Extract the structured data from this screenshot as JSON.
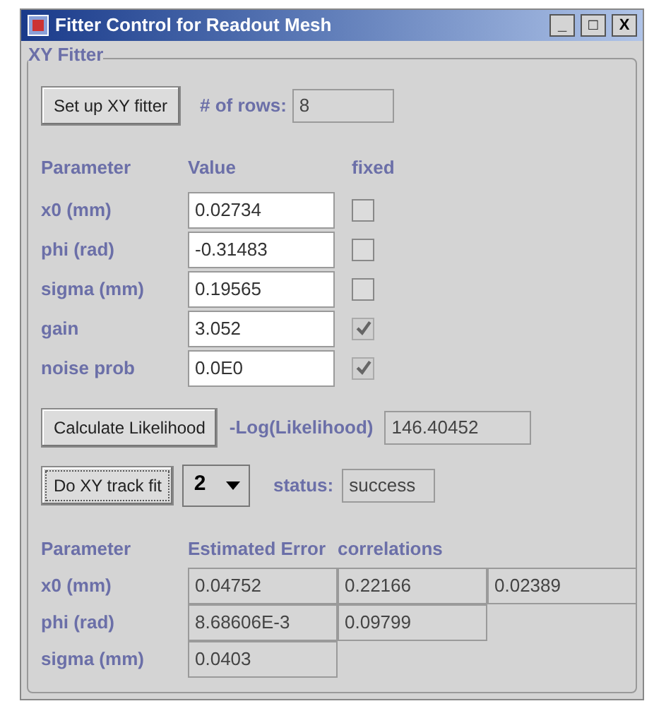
{
  "window": {
    "title": "Fitter Control for Readout Mesh",
    "controls": [
      "_",
      "□",
      "X"
    ]
  },
  "group": {
    "title": "XY Fitter"
  },
  "setup": {
    "button": "Set up XY fitter",
    "rows_label": "# of rows:",
    "rows_value": "8"
  },
  "params": {
    "columns": [
      "Parameter",
      "Value",
      "fixed"
    ],
    "rows": [
      {
        "name": "x0 (mm)",
        "value": "0.02734",
        "checked": false,
        "disabled": false
      },
      {
        "name": "phi (rad)",
        "value": "-0.31483",
        "checked": false,
        "disabled": false
      },
      {
        "name": "sigma (mm)",
        "value": "0.19565",
        "checked": false,
        "disabled": false
      },
      {
        "name": "gain",
        "value": "3.052",
        "checked": true,
        "disabled": true
      },
      {
        "name": "noise prob",
        "value": "0.0E0",
        "checked": true,
        "disabled": true
      }
    ]
  },
  "likelihood": {
    "button": "Calculate Likelihood",
    "label": "-Log(Likelihood)",
    "value": "146.40452"
  },
  "fit": {
    "button": "Do XY track fit",
    "dropdown": "2",
    "status_label": "status:",
    "status_value": "success"
  },
  "errors": {
    "columns": [
      "Parameter",
      "Estimated Error",
      "correlations"
    ],
    "rows": [
      {
        "cells": [
          "x0 (mm)",
          "0.04752",
          "0.22166",
          "0.02389"
        ]
      },
      {
        "cells": [
          "phi (rad)",
          "8.68606E-3",
          "0.09799"
        ]
      },
      {
        "cells": [
          "sigma (mm)",
          "0.0403"
        ]
      }
    ]
  }
}
